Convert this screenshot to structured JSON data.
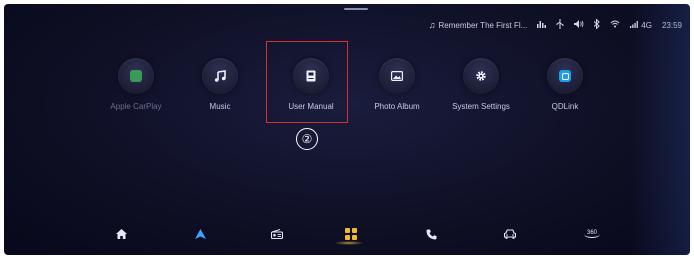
{
  "status_bar": {
    "now_playing": "Remember The First Fl...",
    "network": "4G",
    "time": "23:59",
    "icons": [
      "music-note-icon",
      "equalizer-icon",
      "usb-icon",
      "volume-icon",
      "bluetooth-icon",
      "wifi-icon",
      "signal-icon"
    ]
  },
  "apps": [
    {
      "name": "apple-carplay",
      "label": "Apple CarPlay",
      "icon": "carplay-icon",
      "dimmed": true
    },
    {
      "name": "music",
      "label": "Music",
      "icon": "music-note-icon",
      "dimmed": false
    },
    {
      "name": "user-manual",
      "label": "User Manual",
      "icon": "book-icon",
      "dimmed": false
    },
    {
      "name": "photo-album",
      "label": "Photo Album",
      "icon": "photo-icon",
      "dimmed": false
    },
    {
      "name": "system-settings",
      "label": "System Settings",
      "icon": "gear-icon",
      "dimmed": false
    },
    {
      "name": "qdlink",
      "label": "QDLink",
      "icon": "qdlink-icon",
      "dimmed": false
    }
  ],
  "callout": "②",
  "dock": [
    {
      "name": "home",
      "icon": "home-icon"
    },
    {
      "name": "navigation",
      "icon": "navigation-arrow-icon"
    },
    {
      "name": "radio",
      "icon": "radio-icon"
    },
    {
      "name": "apps",
      "icon": "apps-grid-icon",
      "active": true
    },
    {
      "name": "phone",
      "icon": "phone-icon"
    },
    {
      "name": "car",
      "icon": "car-icon"
    },
    {
      "name": "360-view",
      "icon": "view-360-icon",
      "label": "360"
    }
  ],
  "colors": {
    "background": "#0e0f24",
    "highlight_box": "#d2322d",
    "carplay_green": "#3fae5c",
    "qdlink_blue": "#1b9ef0",
    "apps_active_yellow": "#f2b92c"
  }
}
